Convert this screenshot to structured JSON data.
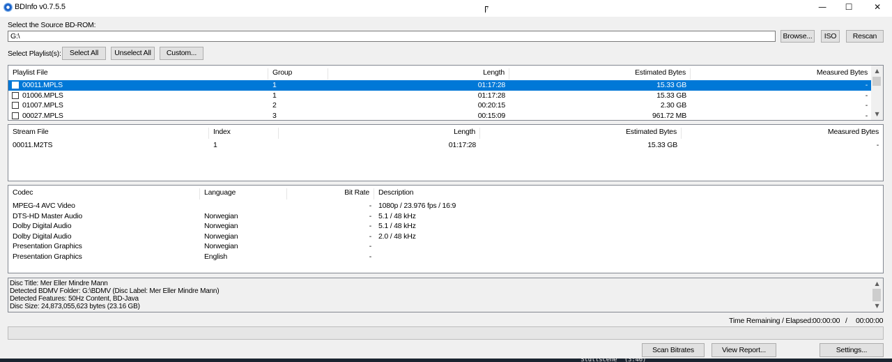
{
  "window": {
    "title": "BDInfo v0.7.5.5",
    "minimize": "—",
    "maximize": "☐",
    "close": "✕"
  },
  "source": {
    "label": "Select the Source BD-ROM:",
    "path": "G:\\",
    "browse": "Browse...",
    "iso": "ISO",
    "rescan": "Rescan"
  },
  "playlist_select": {
    "label": "Select Playlist(s):",
    "select_all": "Select All",
    "unselect_all": "Unselect All",
    "custom": "Custom..."
  },
  "playlists": {
    "headers": [
      "Playlist File",
      "Group",
      "Length",
      "Estimated Bytes",
      "Measured Bytes"
    ],
    "rows": [
      {
        "file": "00011.MPLS",
        "group": "1",
        "length": "01:17:28",
        "est": "15.33 GB",
        "meas": "-",
        "selected": true
      },
      {
        "file": "01006.MPLS",
        "group": "1",
        "length": "01:17:28",
        "est": "15.33 GB",
        "meas": "-"
      },
      {
        "file": "01007.MPLS",
        "group": "2",
        "length": "00:20:15",
        "est": "2.30 GB",
        "meas": "-"
      },
      {
        "file": "00027.MPLS",
        "group": "3",
        "length": "00:15:09",
        "est": "961.72 MB",
        "meas": "-"
      }
    ]
  },
  "streams": {
    "headers": [
      "Stream File",
      "Index",
      "Length",
      "Estimated Bytes",
      "Measured Bytes"
    ],
    "rows": [
      {
        "file": "00011.M2TS",
        "index": "1",
        "length": "01:17:28",
        "est": "15.33 GB",
        "meas": "-"
      }
    ]
  },
  "codecs": {
    "headers": [
      "Codec",
      "Language",
      "Bit Rate",
      "Description"
    ],
    "rows": [
      {
        "codec": "MPEG-4 AVC Video",
        "lang": "",
        "bitrate": "-",
        "desc": "1080p / 23.976 fps / 16:9"
      },
      {
        "codec": "DTS-HD Master Audio",
        "lang": "Norwegian",
        "bitrate": "-",
        "desc": "5.1 / 48 kHz"
      },
      {
        "codec": "Dolby Digital Audio",
        "lang": "Norwegian",
        "bitrate": "-",
        "desc": "5.1 / 48 kHz"
      },
      {
        "codec": "Dolby Digital Audio",
        "lang": "Norwegian",
        "bitrate": "-",
        "desc": "2.0 / 48 kHz"
      },
      {
        "codec": "Presentation Graphics",
        "lang": "Norwegian",
        "bitrate": "-",
        "desc": ""
      },
      {
        "codec": "Presentation Graphics",
        "lang": "English",
        "bitrate": "-",
        "desc": ""
      }
    ]
  },
  "disc_info": [
    "Disc Title: Mer Eller Mindre Mann",
    "Detected BDMV Folder: G:\\BDMV (Disc Label: Mer Eller Mindre Mann)",
    "Detected Features: 50Hz Content, BD-Java",
    "Disc Size: 24,873,055,623 bytes (23.16 GB)"
  ],
  "time": {
    "label": "Time Remaining / Elapsed:",
    "remaining": "00:00:00",
    "sep": "/",
    "elapsed": "00:00:00"
  },
  "progress": {
    "value": 0
  },
  "bottom_buttons": {
    "scan": "Scan Bitrates",
    "report": "View Report...",
    "settings": "Settings..."
  },
  "background_text": "\"Sluttscene\" (3:46)",
  "colors": {
    "selection": "#0078d7",
    "window_bg": "#f0f0f0"
  },
  "icons": {
    "app": "bdinfo-disc-icon",
    "scroll_up": "chevron-up-icon",
    "scroll_down": "chevron-down-icon"
  }
}
